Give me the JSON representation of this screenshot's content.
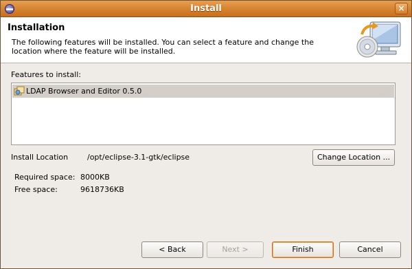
{
  "window": {
    "title": "Install"
  },
  "header": {
    "title": "Installation",
    "description": "The following features will be installed. You can select a feature and change the location where the feature will be installed."
  },
  "features": {
    "label": "Features to install:",
    "items": [
      {
        "label": "LDAP Browser and Editor 0.5.0",
        "icon": "feature-plugin-icon",
        "selected": true
      }
    ]
  },
  "install_location": {
    "label": "Install Location",
    "value": "/opt/eclipse-3.1-gtk/eclipse",
    "change_button": "Change Location ..."
  },
  "space": {
    "required_label": "Required space:",
    "required_value": "8000KB",
    "free_label": "Free space:",
    "free_value": "9618736KB"
  },
  "buttons": {
    "back": "< Back",
    "next": "Next >",
    "finish": "Finish",
    "cancel": "Cancel"
  },
  "colors": {
    "titlebar": "#d88733",
    "selection": "#d3cfc8",
    "window_bg": "#efebe7"
  }
}
